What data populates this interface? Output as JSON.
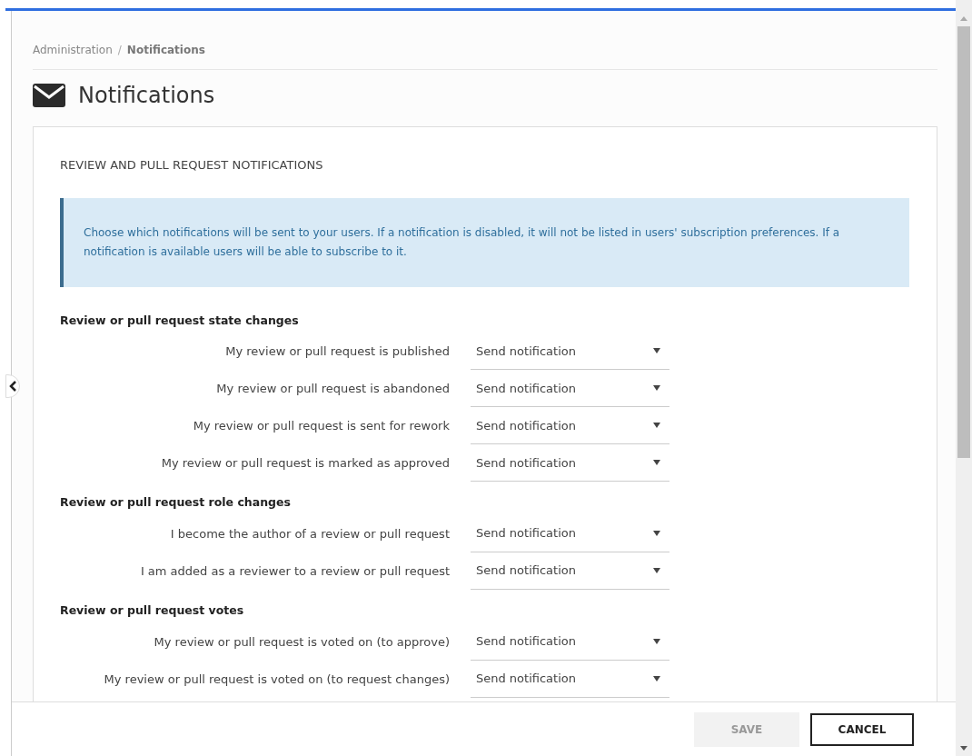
{
  "breadcrumb": {
    "parent": "Administration",
    "separator": "/",
    "current": "Notifications"
  },
  "page_title": "Notifications",
  "card": {
    "heading": "REVIEW AND PULL REQUEST NOTIFICATIONS",
    "info": "Choose which notifications will be sent to your users. If a notification is disabled, it will not be listed in users' subscription preferences. If a notification is available users will be able to subscribe to it.",
    "sections": [
      {
        "title": "Review or pull request state changes",
        "rows": [
          {
            "label": "My review or pull request is published",
            "value": "Send notification"
          },
          {
            "label": "My review or pull request is abandoned",
            "value": "Send notification"
          },
          {
            "label": "My review or pull request is sent for rework",
            "value": "Send notification"
          },
          {
            "label": "My review or pull request is marked as approved",
            "value": "Send notification"
          }
        ]
      },
      {
        "title": "Review or pull request role changes",
        "rows": [
          {
            "label": "I become the author of a review or pull request",
            "value": "Send notification"
          },
          {
            "label": "I am added as a reviewer to a review or pull request",
            "value": "Send notification"
          }
        ]
      },
      {
        "title": "Review or pull request votes",
        "rows": [
          {
            "label": "My review or pull request is voted on (to approve)",
            "value": "Send notification"
          },
          {
            "label": "My review or pull request is voted on (to request changes)",
            "value": "Send notification"
          }
        ]
      }
    ]
  },
  "footer": {
    "buttons": [
      {
        "label": "SAVE",
        "disabled": true
      },
      {
        "label": "CANCEL",
        "disabled": false
      }
    ]
  }
}
